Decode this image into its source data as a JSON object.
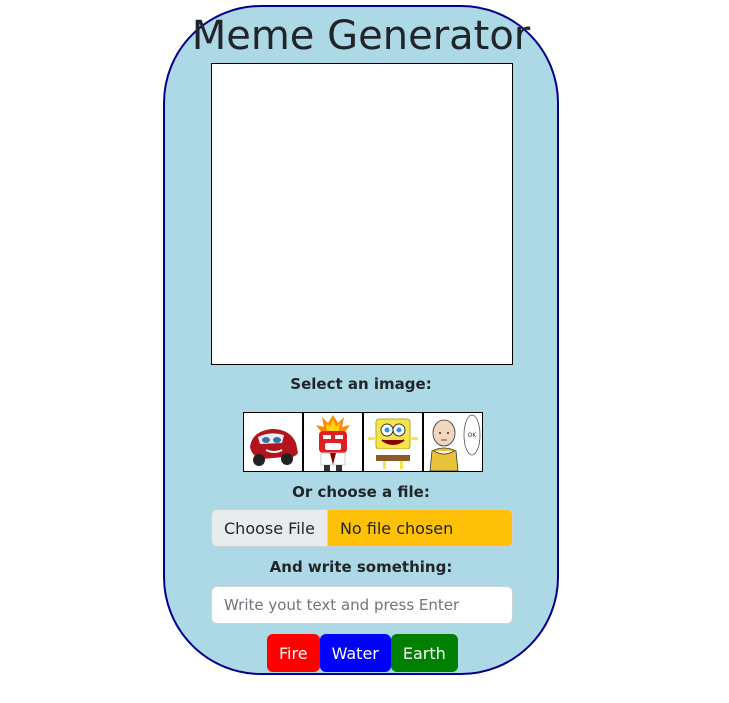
{
  "app": {
    "title": "Meme Generator"
  },
  "labels": {
    "select_image": "Select an image:",
    "choose_file": "Or choose a file:",
    "write_something": "And write something:"
  },
  "thumbnails": [
    {
      "name": "car-cartoon"
    },
    {
      "name": "anger-cartoon"
    },
    {
      "name": "sponge-cartoon"
    },
    {
      "name": "bald-hero-cartoon",
      "speech_text": "OK"
    }
  ],
  "file_input": {
    "button_label": "Choose File",
    "status": "No file chosen"
  },
  "text_input": {
    "placeholder": "Write yout text and press Enter",
    "value": ""
  },
  "buttons": {
    "fire": "Fire",
    "water": "Water",
    "earth": "Earth"
  },
  "colors": {
    "phone_bg": "#add8e6",
    "phone_border": "#00008b",
    "file_bg": "#ffc107",
    "fire": "#ff0000",
    "water": "#0000ff",
    "earth": "#008000"
  }
}
